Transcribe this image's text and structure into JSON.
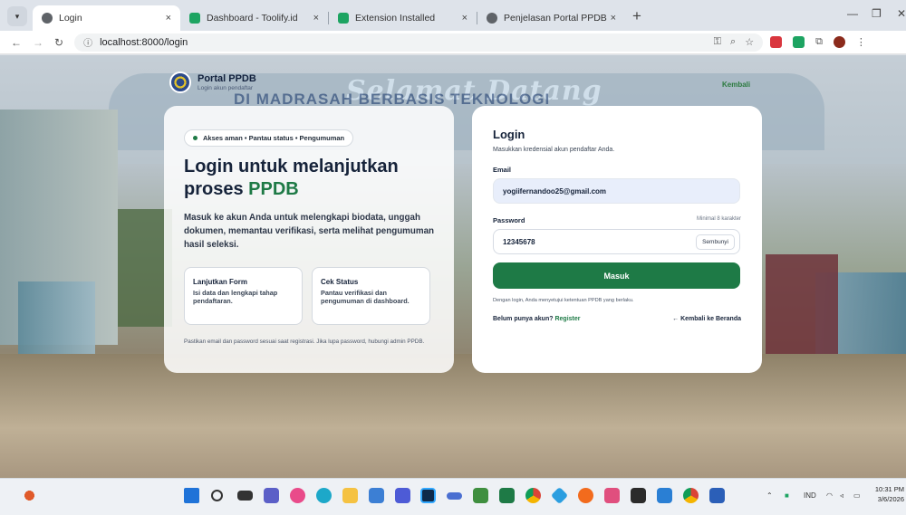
{
  "browser": {
    "tabs": [
      {
        "label": "Login",
        "active": true,
        "icon_color": "#5f6368"
      },
      {
        "label": "Dashboard - Toolify.id",
        "active": false,
        "icon_color": "#1da462"
      },
      {
        "label": "Extension Installed",
        "active": false,
        "icon_color": "#1da462"
      },
      {
        "label": "Penjelasan Portal PPDB Online",
        "active": false,
        "icon_color": "#5f6368"
      }
    ],
    "url": "localhost:8000/login",
    "close_glyph": "×",
    "new_tab_glyph": "+"
  },
  "brand": {
    "title": "Portal PPDB",
    "subtitle": "Login akun pendaftar",
    "back_link": "Kembali"
  },
  "background_text": {
    "arch_line1": "Selamat Datang",
    "arch_line2": "DI MADRASAH BERBASIS TEKNOLOGI"
  },
  "left_panel": {
    "badge": "Akses aman • Pantau status • Pengumuman",
    "headline_1": "Login untuk melanjutkan",
    "headline_2": "proses",
    "headline_highlight": "PPDB",
    "description": "Masuk ke akun Anda untuk melengkapi biodata, unggah dokumen, memantau verifikasi, serta melihat pengumuman hasil seleksi.",
    "cards": [
      {
        "title": "Lanjutkan Form",
        "desc": "Isi data dan lengkapi tahap pendaftaran."
      },
      {
        "title": "Cek Status",
        "desc": "Pantau verifikasi dan pengumuman di dashboard."
      }
    ],
    "note": "Pastikan email dan password sesuai saat registrasi. Jika lupa password, hubungi admin PPDB."
  },
  "login_form": {
    "title": "Login",
    "subtitle": "Masukkan kredensial akun pendaftar Anda.",
    "email_label": "Email",
    "email_value": "yogiifernandoo25@gmail.com",
    "password_label": "Password",
    "password_hint": "Minimal 8 karakter",
    "password_value": "12345678",
    "toggle_label": "Sembunyi",
    "submit_label": "Masuk",
    "terms": "Dengan login, Anda menyetujui ketentuan PPDB yang berlaku.",
    "register_prompt": "Belum punya akun?",
    "register_link": "Register",
    "home_link": "← Kembali ke Beranda"
  },
  "taskbar": {
    "lang": "IND",
    "time": "10:31 PM",
    "date": "3/6/2026"
  },
  "colors": {
    "accent": "#1e7a46",
    "navy": "#16233a"
  }
}
